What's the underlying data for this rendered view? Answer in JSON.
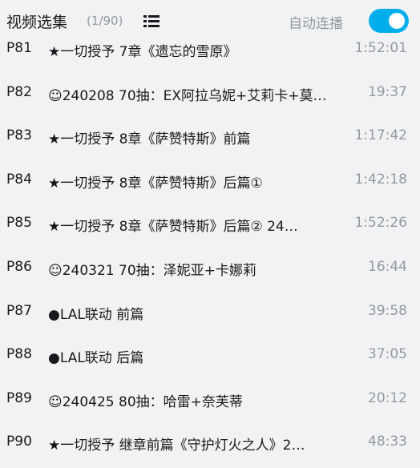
{
  "header": {
    "title": "视频选集",
    "count": "(1/90)",
    "list_icon": "list-icon",
    "autoplay_label": "自动连播",
    "autoplay_on": true,
    "accent_color": "#00aeec"
  },
  "episodes": [
    {
      "ep": "P81",
      "name": "★一切授予 7章《遗忘的雪原》",
      "duration": "1:52:01"
    },
    {
      "ep": "P82",
      "name": "☺240208 70抽：EX阿拉乌妮+艾莉卡+莫…",
      "duration": "19:37"
    },
    {
      "ep": "P83",
      "name": "★一切授予 8章《萨赞特斯》前篇",
      "duration": "1:17:42"
    },
    {
      "ep": "P84",
      "name": "★一切授予 8章《萨赞特斯》后篇①",
      "duration": "1:42:18"
    },
    {
      "ep": "P85",
      "name": "★一切授予 8章《萨赞特斯》后篇② 24…",
      "duration": "1:52:26"
    },
    {
      "ep": "P86",
      "name": "☺240321 70抽：泽妮亚+卡娜莉",
      "duration": "16:44"
    },
    {
      "ep": "P87",
      "name": "●LAL联动 前篇",
      "duration": "39:58"
    },
    {
      "ep": "P88",
      "name": "●LAL联动 后篇",
      "duration": "37:05"
    },
    {
      "ep": "P89",
      "name": "☺240425 80抽：哈雷+奈芙蒂",
      "duration": "20:12"
    },
    {
      "ep": "P90",
      "name": "★一切授予 继章前篇《守护灯火之人》2…",
      "duration": "48:33"
    }
  ]
}
